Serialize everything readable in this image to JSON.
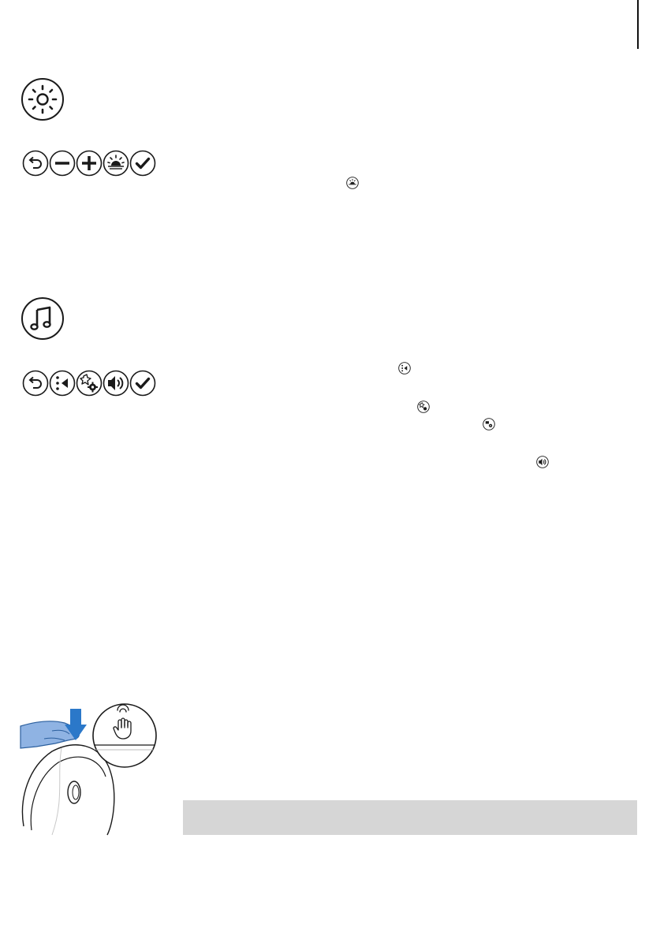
{
  "page": {
    "sections": [
      {
        "id": "light",
        "header_icon": "sun-brightness-icon",
        "buttons": [
          "back-arrow-icon",
          "minus-icon",
          "plus-icon",
          "sunrise-icon",
          "check-icon"
        ],
        "inline_icons": [
          "sunrise-icon"
        ]
      },
      {
        "id": "sound",
        "header_icon": "music-note-icon",
        "buttons": [
          "back-arrow-icon",
          "previous-sound-icon",
          "sound-settings-icon",
          "volume-icon",
          "check-icon"
        ],
        "inline_icons": [
          "previous-sound-icon",
          "sound-settings-icon",
          "sound-settings-alt-icon",
          "volume-icon"
        ]
      }
    ],
    "illustration": {
      "name": "tap-to-snooze-illustration",
      "icons": [
        "blue-down-arrow-icon",
        "hand-tap-icon"
      ]
    },
    "colors": {
      "stroke": "#1a1a1a",
      "accent_blue": "#2b78c9",
      "hand_blue": "#8fb3e3",
      "band_gray": "#d6d6d6"
    }
  }
}
